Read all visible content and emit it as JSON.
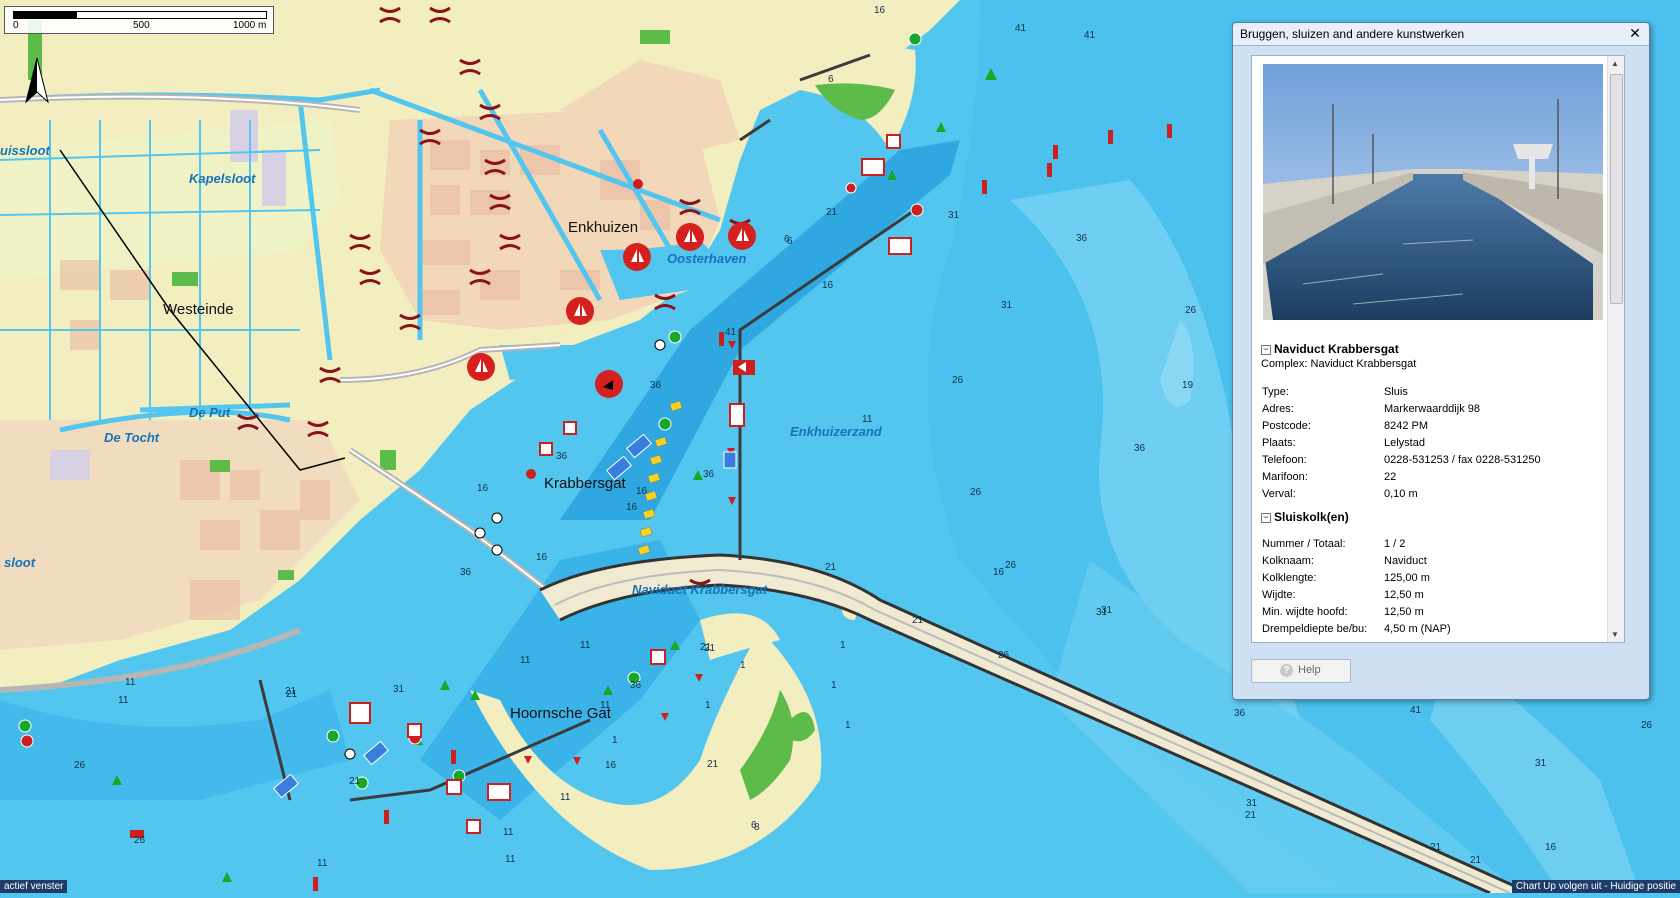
{
  "map": {
    "scale_labels": [
      "0",
      "500",
      "1000 m"
    ],
    "place_names": {
      "enkhuizen": "Enkhuizen",
      "westeinde": "Westeinde",
      "krabbersgat": "Krabbersgat",
      "hoornsche_gat": "Hoornsche Gat",
      "kapelsloot": "Kapelsloot",
      "oosterhaven": "Oosterhaven",
      "de_put": "De Put",
      "de_tocht": "De Tocht",
      "enkhuizerzand": "Enkhuizerzand",
      "naviduct_krabbersgat": "Naviduct Krabbersgat",
      "uissloot": "uissloot",
      "sloot": "sloot"
    },
    "depths": [
      "16",
      "41",
      "41",
      "6",
      "21",
      "31",
      "16",
      "6",
      "36",
      "31",
      "26",
      "41",
      "36",
      "26",
      "16",
      "36",
      "16",
      "26",
      "16",
      "36",
      "36",
      "16",
      "21",
      "21",
      "16",
      "31",
      "26",
      "21",
      "11",
      "31",
      "21",
      "21",
      "36",
      "36",
      "21",
      "26",
      "16",
      "21",
      "11",
      "26",
      "36",
      "21",
      "21",
      "21",
      "11",
      "31",
      "26",
      "26",
      "31",
      "26",
      "41",
      "16",
      "6",
      "11",
      "21",
      "11",
      "31",
      "11",
      "19",
      "11",
      "8",
      "11",
      "11",
      "11",
      "6",
      "1",
      "1",
      "1",
      "1",
      "1",
      "1"
    ]
  },
  "status": {
    "left": "actief venster",
    "right": "Chart Up volgen uit - Huidige positie"
  },
  "info_window": {
    "title": "Bruggen, sluizen and andere kunstwerken",
    "close_symbol": "✕",
    "object_name": "Naviduct Krabbersgat",
    "complex_line": "Complex: Naviduct Krabbersgat",
    "properties": [
      {
        "label": "Type:",
        "value": "Sluis"
      },
      {
        "label": "Adres:",
        "value": "Markerwaarddijk 98"
      },
      {
        "label": "Postcode:",
        "value": "8242 PM"
      },
      {
        "label": "Plaats:",
        "value": "Lelystad"
      },
      {
        "label": "Telefoon:",
        "value": "0228-531253 / fax 0228-531250"
      },
      {
        "label": "Marifoon:",
        "value": "22"
      },
      {
        "label": "Verval:",
        "value": "0,10 m"
      }
    ],
    "section2_title": "Sluiskolk(en)",
    "chambers": [
      {
        "label": "Nummer / Totaal:",
        "value": "1 / 2"
      },
      {
        "label": "Kolknaam:",
        "value": "Naviduct"
      },
      {
        "label": "Kolklengte:",
        "value": "125,00 m"
      },
      {
        "label": "Wijdte:",
        "value": "12,50 m"
      },
      {
        "label": "Min. wijdte hoofd:",
        "value": "12,50 m"
      },
      {
        "label": "Drempeldiepte be/bu:",
        "value": "4,50 m (NAP)"
      }
    ],
    "help_label": "Help"
  }
}
